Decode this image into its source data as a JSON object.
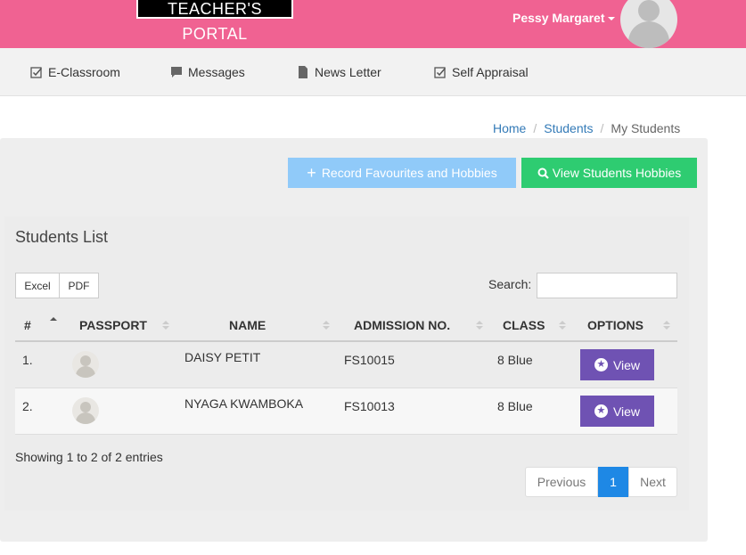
{
  "header": {
    "brand": "TEACHER'S PORTAL",
    "user_name": "Pessy Margaret"
  },
  "nav": {
    "items": [
      {
        "label": "E-Classroom",
        "icon": "checkbox-icon"
      },
      {
        "label": "Messages",
        "icon": "chat-icon"
      },
      {
        "label": "News Letter",
        "icon": "document-icon"
      },
      {
        "label": "Self Appraisal",
        "icon": "checkbox-icon"
      }
    ]
  },
  "breadcrumb": {
    "home": "Home",
    "students": "Students",
    "current": "My Students"
  },
  "actions": {
    "record_label": "Record Favourites and Hobbies",
    "view_hobbies_label": "View Students Hobbies"
  },
  "table_box": {
    "title": "Students List",
    "export_excel": "Excel",
    "export_pdf": "PDF",
    "search_label": "Search:",
    "search_value": "",
    "columns": [
      "#",
      "PASSPORT",
      "NAME",
      "ADMISSION NO.",
      "CLASS",
      "OPTIONS"
    ],
    "rows": [
      {
        "num": "1.",
        "name": "DAISY PETIT",
        "admission": "FS10015",
        "class": "8 Blue",
        "action": "View"
      },
      {
        "num": "2.",
        "name": "NYAGA KWAMBOKA",
        "admission": "FS10013",
        "class": "8 Blue",
        "action": "View"
      }
    ],
    "info": "Showing 1 to 2 of 2 entries",
    "pager": {
      "prev": "Previous",
      "page": "1",
      "next": "Next"
    }
  },
  "colors": {
    "header": "#f06292",
    "record_button": "#90caf9",
    "view_hobbies_button": "#2ecc71",
    "view_button": "#6f52b3",
    "active_page": "#1e88e5"
  }
}
